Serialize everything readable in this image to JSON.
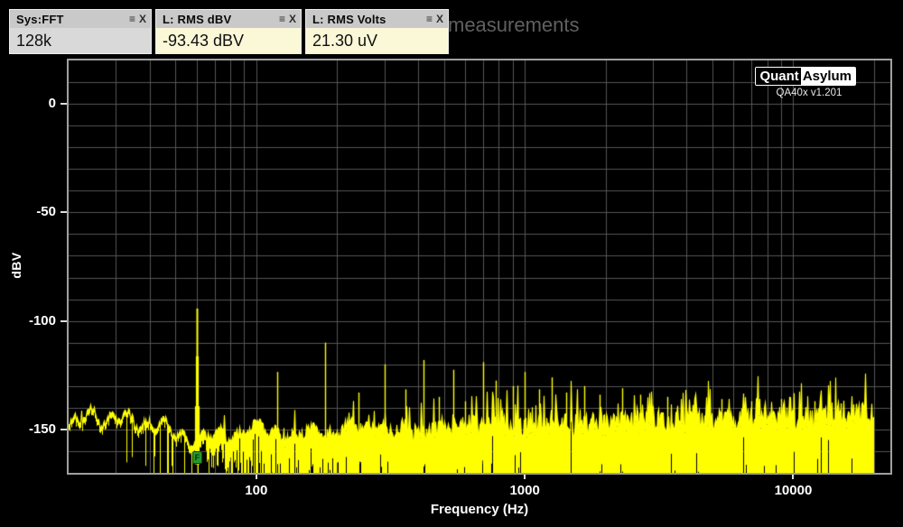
{
  "window": {
    "background_text_fragment": "measurements"
  },
  "panel_controls": {
    "menu_icon": "≡",
    "close_icon": "X"
  },
  "panels": [
    {
      "title": "Sys:FFT",
      "value": "128k",
      "body_bg": "#d9d9d9"
    },
    {
      "title": "L: RMS dBV",
      "value": "-93.43 dBV",
      "body_bg": "#fbf8d8"
    },
    {
      "title": "L: RMS Volts",
      "value": "21.30 uV",
      "body_bg": "#fbf8d8"
    }
  ],
  "branding": {
    "logo_left": "Quant",
    "logo_right": "Asylum",
    "version": "QA40x v1.201"
  },
  "chart_data": {
    "type": "line",
    "title": "",
    "xlabel": "Frequency (Hz)",
    "ylabel": "dBV",
    "x_scale": "log",
    "xlim": [
      20,
      23000
    ],
    "ylim": [
      -170,
      20
    ],
    "grid_step_db": 10,
    "grid_on": true,
    "grid_color": "#565656",
    "trace_color": "#ffff00",
    "data_range_hz": [
      20,
      20000
    ],
    "x_ticks": [
      {
        "label": "100",
        "hz": 100
      },
      {
        "label": "1000",
        "hz": 1000
      },
      {
        "label": "10000",
        "hz": 10000
      }
    ],
    "y_ticks": [
      {
        "label": "0",
        "db": 0
      },
      {
        "label": "-50",
        "db": -50
      },
      {
        "label": "-100",
        "db": -100
      },
      {
        "label": "-150",
        "db": -150
      }
    ],
    "noise_floor_envelope_db": [
      [
        20,
        -150
      ],
      [
        24,
        -137
      ],
      [
        28,
        -147
      ],
      [
        35,
        -147
      ],
      [
        45,
        -150
      ],
      [
        60,
        -152
      ],
      [
        80,
        -153
      ],
      [
        100,
        -152
      ],
      [
        150,
        -151
      ],
      [
        300,
        -150
      ],
      [
        600,
        -149
      ],
      [
        1200,
        -148
      ],
      [
        2500,
        -147
      ],
      [
        5000,
        -146
      ],
      [
        10000,
        -145
      ],
      [
        16000,
        -144
      ],
      [
        20000,
        -143
      ]
    ],
    "peaks": [
      {
        "hz": 60,
        "db": -94.3
      },
      {
        "hz": 120,
        "db": -123.5
      },
      {
        "hz": 180,
        "db": -110
      },
      {
        "hz": 240,
        "db": -133
      },
      {
        "hz": 300,
        "db": -120
      },
      {
        "hz": 360,
        "db": -131.5
      },
      {
        "hz": 420,
        "db": -118
      },
      {
        "hz": 480,
        "db": -135
      },
      {
        "hz": 540,
        "db": -122.5
      },
      {
        "hz": 600,
        "db": -137
      },
      {
        "hz": 700,
        "db": -119
      },
      {
        "hz": 780,
        "db": -127.5
      },
      {
        "hz": 900,
        "db": -130
      },
      {
        "hz": 1000,
        "db": -123.5
      },
      {
        "hz": 1130,
        "db": -131.5
      },
      {
        "hz": 1260,
        "db": -126
      },
      {
        "hz": 1430,
        "db": -133
      },
      {
        "hz": 1660,
        "db": -130
      },
      {
        "hz": 1900,
        "db": -134
      },
      {
        "hz": 2300,
        "db": -131
      },
      {
        "hz": 2700,
        "db": -134
      },
      {
        "hz": 3400,
        "db": -135
      },
      {
        "hz": 4300,
        "db": -136
      },
      {
        "hz": 5400,
        "db": -136
      },
      {
        "hz": 7000,
        "db": -137
      },
      {
        "hz": 9000,
        "db": -136
      },
      {
        "hz": 12000,
        "db": -137
      },
      {
        "hz": 15000,
        "db": -138
      }
    ],
    "markers": [
      {
        "label": "F",
        "hz": 60,
        "db": -162,
        "color": "#27972f"
      }
    ]
  }
}
